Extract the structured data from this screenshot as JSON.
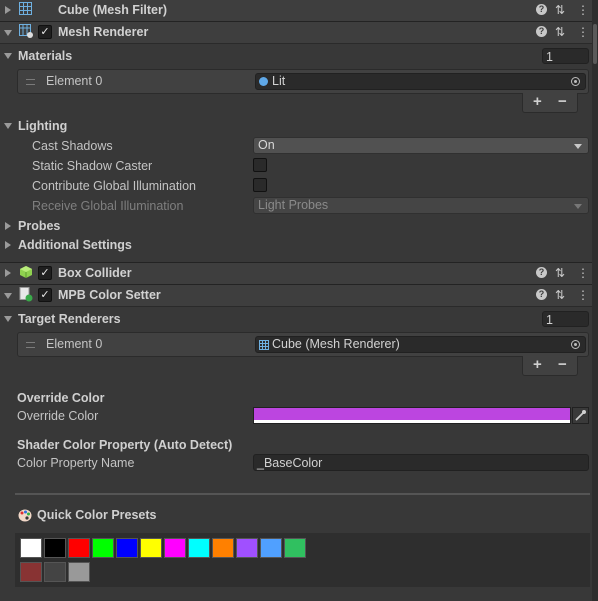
{
  "mesh_filter": {
    "title": "Cube (Mesh Filter)"
  },
  "mesh_renderer": {
    "title": "Mesh Renderer",
    "materials_label": "Materials",
    "materials_count": "1",
    "element0_label": "Element 0",
    "element0_value": "Lit",
    "lighting_label": "Lighting",
    "cast_shadows_label": "Cast Shadows",
    "cast_shadows_value": "On",
    "static_shadow_label": "Static Shadow Caster",
    "contribute_gi_label": "Contribute Global Illumination",
    "receive_gi_label": "Receive Global Illumination",
    "receive_gi_value": "Light Probes",
    "probes_label": "Probes",
    "additional_label": "Additional Settings"
  },
  "box_collider": {
    "title": "Box Collider"
  },
  "mpb": {
    "title": "MPB Color Setter",
    "target_renderers_label": "Target Renderers",
    "target_count": "1",
    "element0_label": "Element 0",
    "element0_value": "Cube (Mesh Renderer)",
    "override_header": "Override Color",
    "override_label": "Override Color",
    "override_color": "#bc45e0",
    "shader_header": "Shader Color Property (Auto Detect)",
    "color_prop_label": "Color Property Name",
    "color_prop_value": "_BaseColor",
    "presets_header": "Quick Color Presets",
    "presets": [
      "#ffffff",
      "#000000",
      "#ff0000",
      "#00ff00",
      "#0000ff",
      "#ffff00",
      "#ff00ff",
      "#00ffff",
      "#ff8000",
      "#a050ff",
      "#50a0ff",
      "#30c060",
      "#883333",
      "#444444",
      "#999999"
    ]
  },
  "icons": {
    "help": "?",
    "presets_toggle": "⇅",
    "more": "⋮",
    "check": "✓",
    "plus": "+",
    "minus": "−",
    "eyedropper": "eyedropper-icon",
    "palette": "palette-icon"
  }
}
